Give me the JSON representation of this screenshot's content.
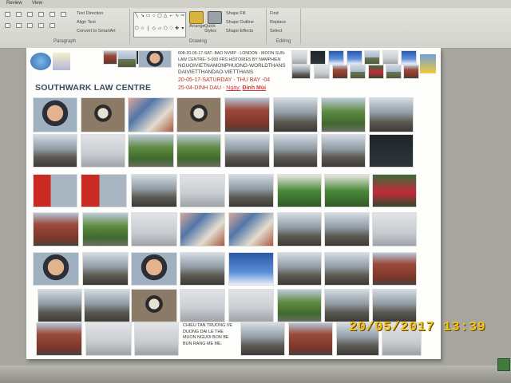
{
  "ribbon": {
    "menu": [
      "Review",
      "View"
    ],
    "paragraph": {
      "label": "Paragraph",
      "text_direction": "Text Direction",
      "align_text": "Align Text",
      "smartart": "Convert to SmartArt"
    },
    "drawing": {
      "label": "Drawing",
      "arrange": "Arrange",
      "quick_styles": "Quick Styles",
      "shape_fill": "Shape Fill",
      "shape_outline": "Shape Outline",
      "shape_effects": "Shape Effects"
    },
    "editing": {
      "label": "Editing",
      "find": "Find",
      "replace": "Replace",
      "select": "Select"
    }
  },
  "document": {
    "header_lines": [
      "608-20-05-17-SAT- BAO NVMP - LONDON - MOON SUN-",
      "LAW CENTRE- 5-000 FRS HISTORIES BY NAMPHIEN",
      "NGUOIVIETNAMONPHUONG-WORLDTHANS",
      "DAIVIETTHANDAO-VIETTHANS"
    ],
    "date_line_1": "20-05-17-SATURDAY - THU BAY -04",
    "date_line_2_prefix": "25-04-DINH DAU - ",
    "date_line_2_label": "Ngày:",
    "date_line_2_value": "Đinh Mùi",
    "title": "SOUTHWARK LAW CENTRE",
    "caption_lines": [
      "CHIEU TAN TRUONG VE",
      "DUONG DAI LE THE",
      "MUON NGUOI BON BE",
      "BUN RANG ME ME."
    ],
    "caption_underlined": "ME."
  },
  "camera_date_stamp": "20/05/2017  13:39",
  "colors": {
    "title": "#3b4a5e",
    "date_line": "#c23b2a",
    "header_text": "#3a3a3a",
    "stamp": "#f2c21b"
  },
  "photo_grid": {
    "note": "",
    "palettes": [
      "sky",
      "brick",
      "street",
      "tree",
      "grey",
      "night",
      "person",
      "bus",
      "art"
    ]
  }
}
